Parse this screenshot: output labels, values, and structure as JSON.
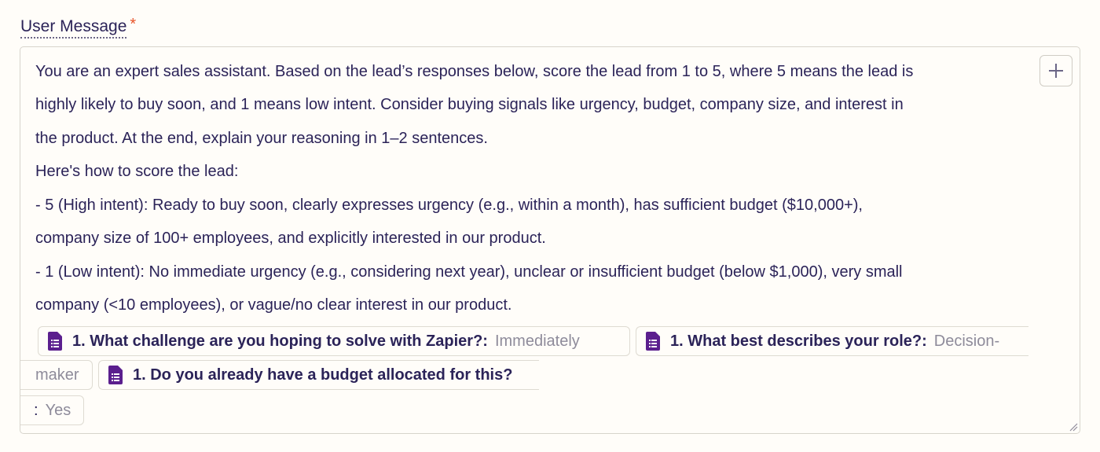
{
  "field": {
    "label": "User Message",
    "required_mark": "*"
  },
  "editor": {
    "lines": [
      "You are an expert sales assistant. Based on the lead’s responses below, score the lead from 1 to 5, where 5 means the lead is",
      "highly likely to buy soon, and 1 means low intent. Consider buying signals like urgency, budget, company size, and interest in",
      "the product. At the end, explain your reasoning in 1–2 sentences.",
      "Here's how to score the lead:",
      "- 5 (High intent): Ready to buy soon, clearly expresses urgency (e.g., within a month), has sufficient budget ($10,000+),",
      "company size of 100+ employees, and explicitly interested in our product.",
      "- 1 (Low intent): No immediate urgency (e.g., considering next year), unclear or insufficient budget (below $1,000), very small",
      "company (<10 employees), or vague/no clear interest in our product."
    ],
    "pills": [
      {
        "question": "1. What challenge are you hoping to solve with Zapier?:",
        "answer": "Immediately",
        "icon": "form-doc-icon"
      },
      {
        "question": "1. What best describes your role?:",
        "answer_part1": "Decision-",
        "answer_part2": "maker",
        "icon": "form-doc-icon"
      },
      {
        "question": "1. Do you already have a budget allocated for this?",
        "answer_colon": ":",
        "answer": "Yes",
        "icon": "form-doc-icon"
      }
    ],
    "add_button_icon": "plus-icon",
    "resize_icon": "resize-handle-icon",
    "colors": {
      "accent_purple": "#5b1f8e",
      "required_red": "#e8542a",
      "text": "#2b2358",
      "muted": "#8e8b9a"
    }
  }
}
